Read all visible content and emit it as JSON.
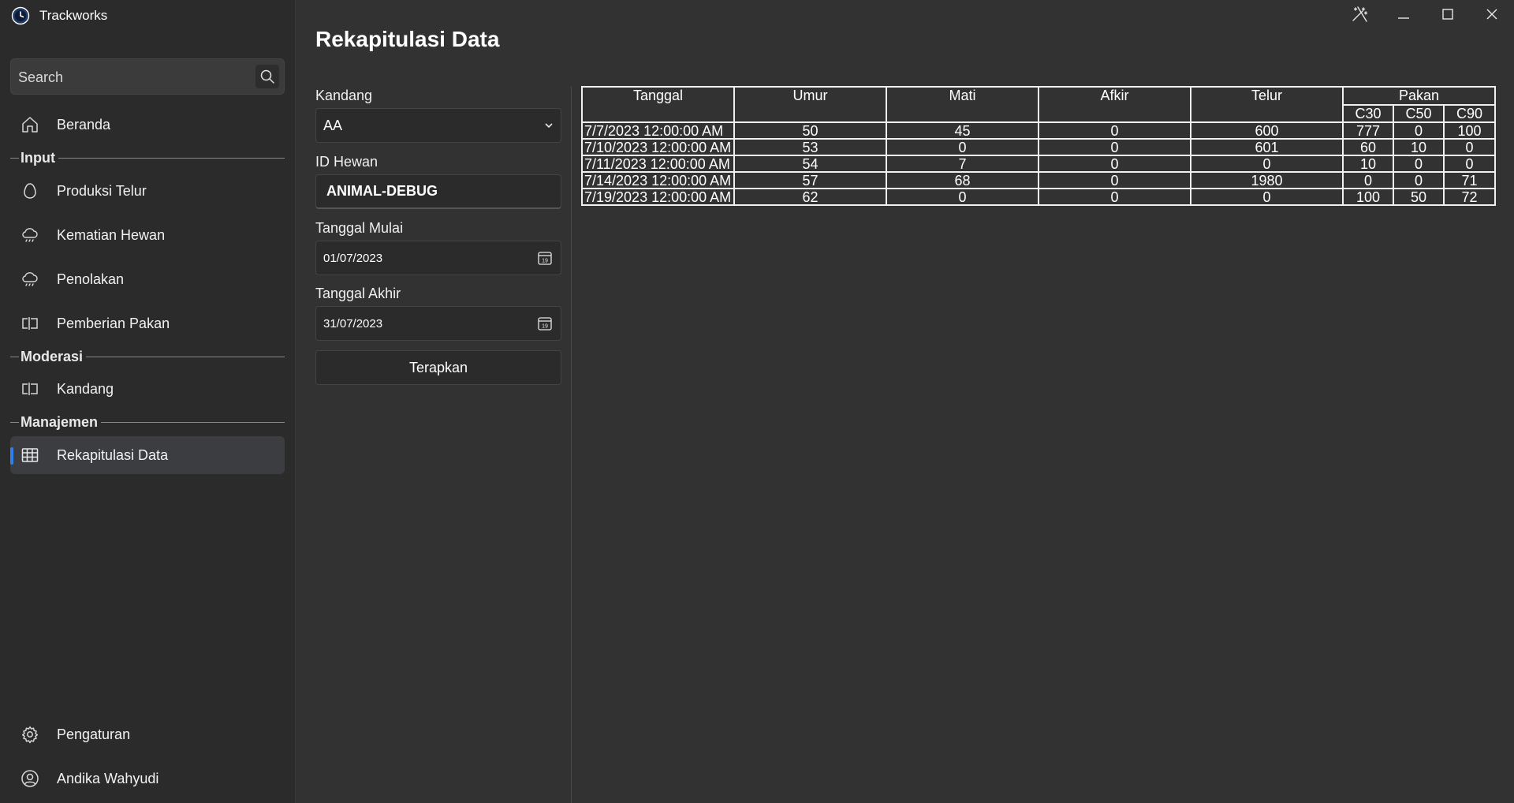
{
  "app": {
    "title": "Trackworks"
  },
  "sidebar": {
    "search_placeholder": "Search",
    "items": [
      {
        "label": "Beranda",
        "icon": "home-icon"
      },
      {
        "label": "Produksi Telur",
        "icon": "egg-icon"
      },
      {
        "label": "Kematian Hewan",
        "icon": "cloud-rain-icon"
      },
      {
        "label": "Penolakan",
        "icon": "cloud-rain-icon"
      },
      {
        "label": "Pemberian Pakan",
        "icon": "feed-icon"
      },
      {
        "label": "Kandang",
        "icon": "feed-icon"
      },
      {
        "label": "Rekapitulasi Data",
        "icon": "table-icon"
      }
    ],
    "sections": [
      "Input",
      "Moderasi",
      "Manajemen"
    ],
    "footer": {
      "settings_label": "Pengaturan",
      "user_name": "Andika Wahyudi"
    },
    "active_item": "Rekapitulasi Data"
  },
  "page": {
    "title": "Rekapitulasi Data"
  },
  "form": {
    "kandang_label": "Kandang",
    "kandang_value": "AA",
    "id_hewan_label": "ID Hewan",
    "id_hewan_value": "ANIMAL-DEBUG",
    "tanggal_mulai_label": "Tanggal Mulai",
    "tanggal_mulai_value": "01/07/2023",
    "tanggal_akhir_label": "Tanggal Akhir",
    "tanggal_akhir_value": "31/07/2023",
    "apply_label": "Terapkan"
  },
  "table": {
    "headers": [
      "Tanggal",
      "Umur",
      "Mati",
      "Afkir",
      "Telur",
      "Pakan"
    ],
    "pakan_subheaders": [
      "C30",
      "C50",
      "C90"
    ],
    "rows": [
      [
        "7/7/2023 12:00:00 AM",
        "50",
        "45",
        "0",
        "600",
        "777",
        "0",
        "100"
      ],
      [
        "7/10/2023 12:00:00 AM",
        "53",
        "0",
        "0",
        "601",
        "60",
        "10",
        "0"
      ],
      [
        "7/11/2023 12:00:00 AM",
        "54",
        "7",
        "0",
        "0",
        "10",
        "0",
        "0"
      ],
      [
        "7/14/2023 12:00:00 AM",
        "57",
        "68",
        "0",
        "1980",
        "0",
        "0",
        "71"
      ],
      [
        "7/19/2023 12:00:00 AM",
        "62",
        "0",
        "0",
        "0",
        "100",
        "50",
        "72"
      ]
    ]
  },
  "colors": {
    "accent": "#2f80ed",
    "background": "#323232",
    "sidebar": "#2b2b2b"
  }
}
